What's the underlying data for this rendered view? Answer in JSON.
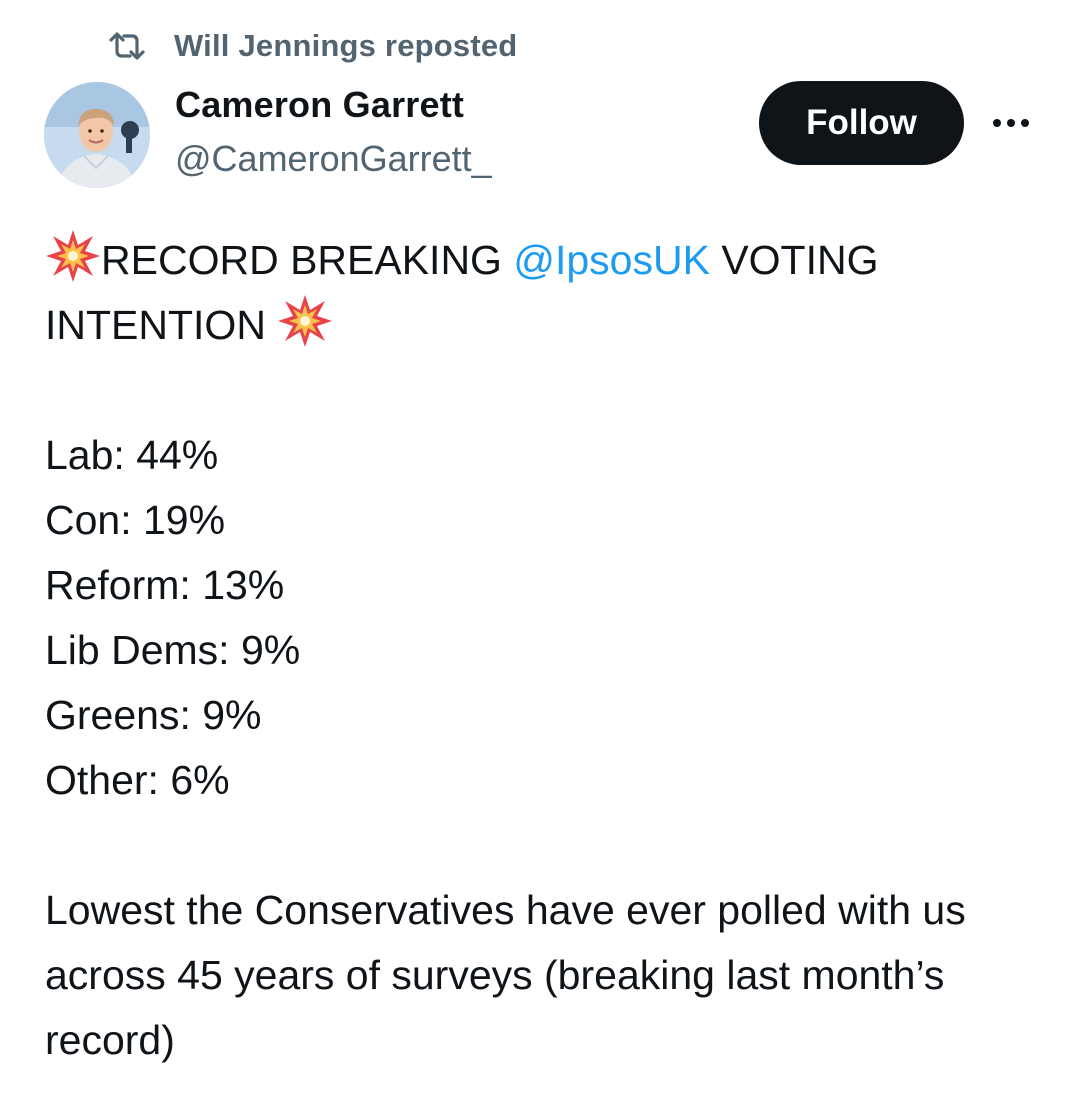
{
  "repost": {
    "icon": "repost-icon",
    "text": "Will Jennings reposted"
  },
  "author": {
    "name": "Cameron Garrett",
    "handle": "@CameronGarrett_",
    "avatar_icon": "avatar"
  },
  "actions": {
    "follow_label": "Follow",
    "more_icon": "more-options-icon"
  },
  "tweet": {
    "headline_pre": "RECORD BREAKING ",
    "mention": "@IpsosUK",
    "headline_post": " VOTING INTENTION ",
    "emoji": "collision-emoji",
    "results": [
      "Lab: 44%",
      "Con: 19%",
      "Reform: 13%",
      "Lib Dems: 9%",
      "Greens: 9%",
      "Other: 6%"
    ],
    "footer": "Lowest the Conservatives have ever polled with us across 45 years of surveys (breaking last month’s record)"
  },
  "colors": {
    "text": "#0f1419",
    "secondary": "#536471",
    "link": "#1d9bf0",
    "follow_bg": "#0f1419",
    "follow_text": "#ffffff"
  }
}
